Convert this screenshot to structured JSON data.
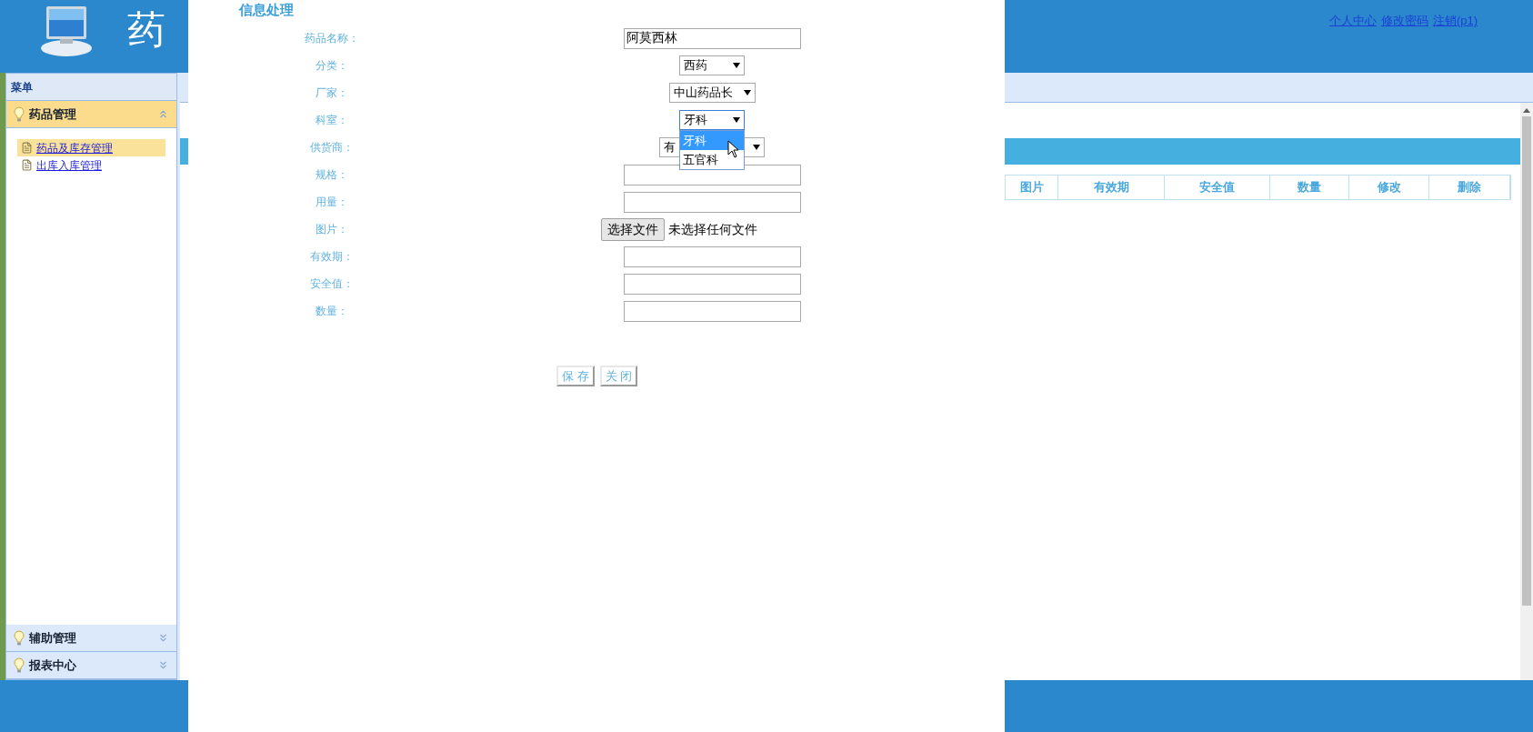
{
  "header": {
    "title": "药",
    "links": [
      "个人中心",
      "修改密码",
      "注销(p1)"
    ]
  },
  "sidebar": {
    "title": "菜单",
    "panels": [
      {
        "label": "药品管理",
        "expanded": true,
        "items": [
          {
            "label": "药品及库存管理",
            "selected": true
          },
          {
            "label": "出库入库管理",
            "selected": false
          }
        ]
      },
      {
        "label": "辅助管理",
        "expanded": false
      },
      {
        "label": "报表中心",
        "expanded": false
      }
    ]
  },
  "table": {
    "columns": [
      "图片",
      "有效期",
      "安全值",
      "数量",
      "修改",
      "删除"
    ]
  },
  "dialog": {
    "title": "信息处理",
    "fields": [
      {
        "kind": "text",
        "label": "药品名称：",
        "value": "阿莫西林"
      },
      {
        "kind": "select",
        "label": "分类：",
        "value": "西药",
        "expanded": false
      },
      {
        "kind": "select",
        "label": "厂家：",
        "value": "中山药品长",
        "expanded": false
      },
      {
        "kind": "select",
        "label": "科室：",
        "value": "牙科",
        "expanded": true,
        "options": [
          {
            "label": "牙科",
            "selected": true
          },
          {
            "label": "五官科",
            "selected": false
          }
        ]
      },
      {
        "kind": "select",
        "label": "供货商：",
        "value": "有",
        "expanded": false
      },
      {
        "kind": "text",
        "label": "规格："
      },
      {
        "kind": "text",
        "label": "用量："
      },
      {
        "kind": "file",
        "label": "图片：",
        "button": "选择文件",
        "status": "未选择任何文件"
      },
      {
        "kind": "text",
        "label": "有效期："
      },
      {
        "kind": "text",
        "label": "安全值："
      },
      {
        "kind": "text",
        "label": "数量："
      }
    ],
    "buttons": [
      "保 存",
      "关 闭"
    ]
  }
}
